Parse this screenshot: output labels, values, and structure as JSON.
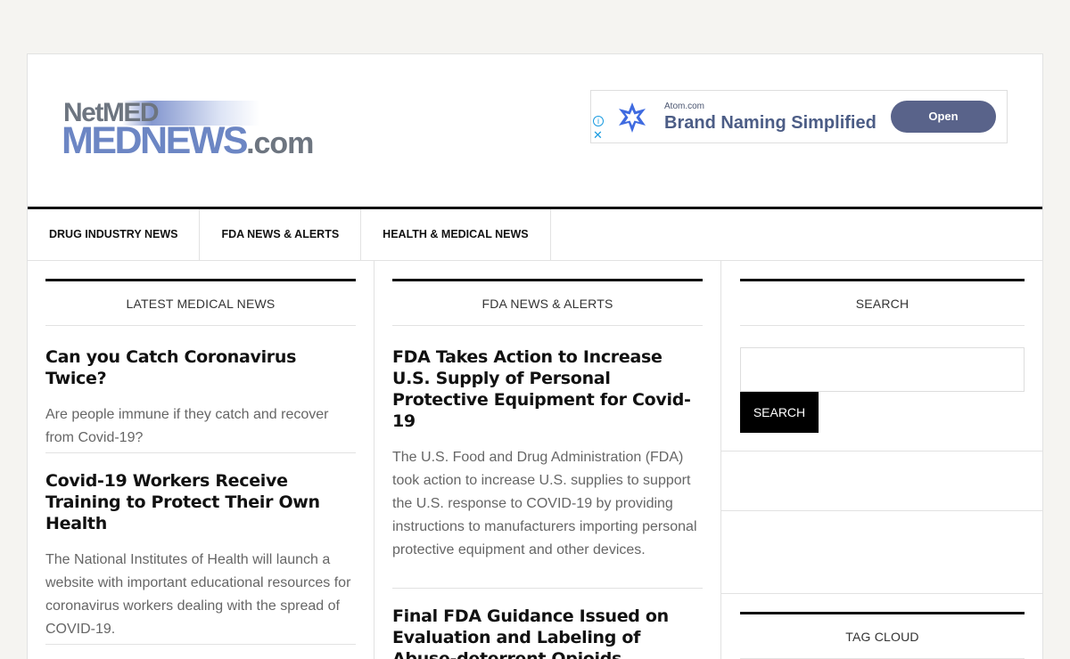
{
  "header": {
    "logo_top": "NetMED",
    "logo_main": "MEDNEWS",
    "logo_suffix": ".com"
  },
  "ad": {
    "source": "Atom.com",
    "headline": "Brand Naming Simplified",
    "button_label": "Open",
    "close_glyph": "✕",
    "info_glyph": "i"
  },
  "nav": {
    "items": [
      "DRUG INDUSTRY NEWS",
      "FDA NEWS & ALERTS",
      "HEALTH & MEDICAL NEWS"
    ]
  },
  "latest": {
    "title": "LATEST MEDICAL NEWS",
    "posts": [
      {
        "headline": "Can you Catch Coronavirus Twice?",
        "excerpt": "Are people immune if they catch and recover from Covid-19?"
      },
      {
        "headline": "Covid-19 Workers Receive Training to Protect Their Own Health",
        "excerpt": "The National Institutes of Health will launch a website with important educational resources for coronavirus workers dealing with the spread of COVID-19."
      }
    ]
  },
  "fda": {
    "title": "FDA NEWS & ALERTS",
    "posts": [
      {
        "headline": "FDA Takes Action to Increase U.S. Supply of Personal Protective Equipment for Covid-19",
        "excerpt": "The U.S. Food and Drug Administration (FDA) took action to increase U.S. supplies to support the U.S. response to COVID-19 by providing instructions to manufacturers importing personal protective equipment and other devices."
      },
      {
        "headline": "Final FDA Guidance Issued on Evaluation and Labeling of Abuse-deterrent Opioids",
        "excerpt": ""
      }
    ]
  },
  "sidebar": {
    "search_title": "SEARCH",
    "search_button": "SEARCH",
    "search_placeholder": "",
    "tag_cloud_title": "TAG CLOUD"
  },
  "colors": {
    "page_bg": "#f5f4f1",
    "logo_blue": "#6c86c4",
    "logo_gray": "#6d7580",
    "ad_button": "#59638a",
    "ad_info": "#1a9be0"
  }
}
